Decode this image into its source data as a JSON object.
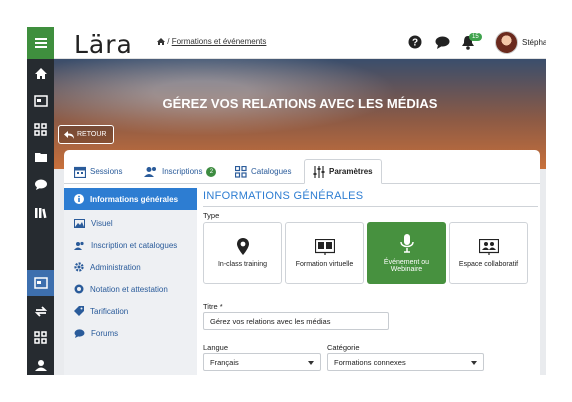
{
  "header": {
    "logo": "Lära",
    "breadcrumb": "Formations et événements",
    "badge": "15",
    "user_name": "Stéphanie"
  },
  "hero": {
    "title": "GÉREZ VOS RELATIONS AVEC LES MÉDIAS",
    "back_label": "RETOUR"
  },
  "tabs": [
    {
      "label": "Sessions",
      "icon": "calendar-icon"
    },
    {
      "label": "Inscriptions",
      "icon": "users-icon",
      "count": "2"
    },
    {
      "label": "Catalogues",
      "icon": "grid-icon"
    },
    {
      "label": "Paramètres",
      "icon": "sliders-icon"
    }
  ],
  "sidebar": {
    "items": [
      {
        "label": "Informations générales",
        "icon": "info-icon"
      },
      {
        "label": "Visuel",
        "icon": "image-icon"
      },
      {
        "label": "Inscription et catalogues",
        "icon": "users-icon"
      },
      {
        "label": "Administration",
        "icon": "gear-icon"
      },
      {
        "label": "Notation et attestation",
        "icon": "badge-icon"
      },
      {
        "label": "Tarification",
        "icon": "tag-icon"
      },
      {
        "label": "Forums",
        "icon": "chat-icon"
      }
    ]
  },
  "main": {
    "section_title": "INFORMATIONS GÉNÉRALES",
    "type_label": "Type",
    "types": [
      {
        "label": "In-class training",
        "icon": "location-pin-icon"
      },
      {
        "label": "Formation virtuelle",
        "icon": "presentation-icon"
      },
      {
        "label": "Événement ou Webinaire",
        "icon": "microphone-icon"
      },
      {
        "label": "Espace collaboratif",
        "icon": "collab-icon"
      }
    ],
    "title_label": "Titre *",
    "title_value": "Gérez vos relations avec les médias",
    "language_label": "Langue",
    "language_value": "Français",
    "category_label": "Catégorie",
    "category_value": "Formations connexes"
  },
  "colors": {
    "accent_green": "#47913f",
    "accent_blue": "#2d7dd2",
    "rail_dark": "#262b30"
  }
}
